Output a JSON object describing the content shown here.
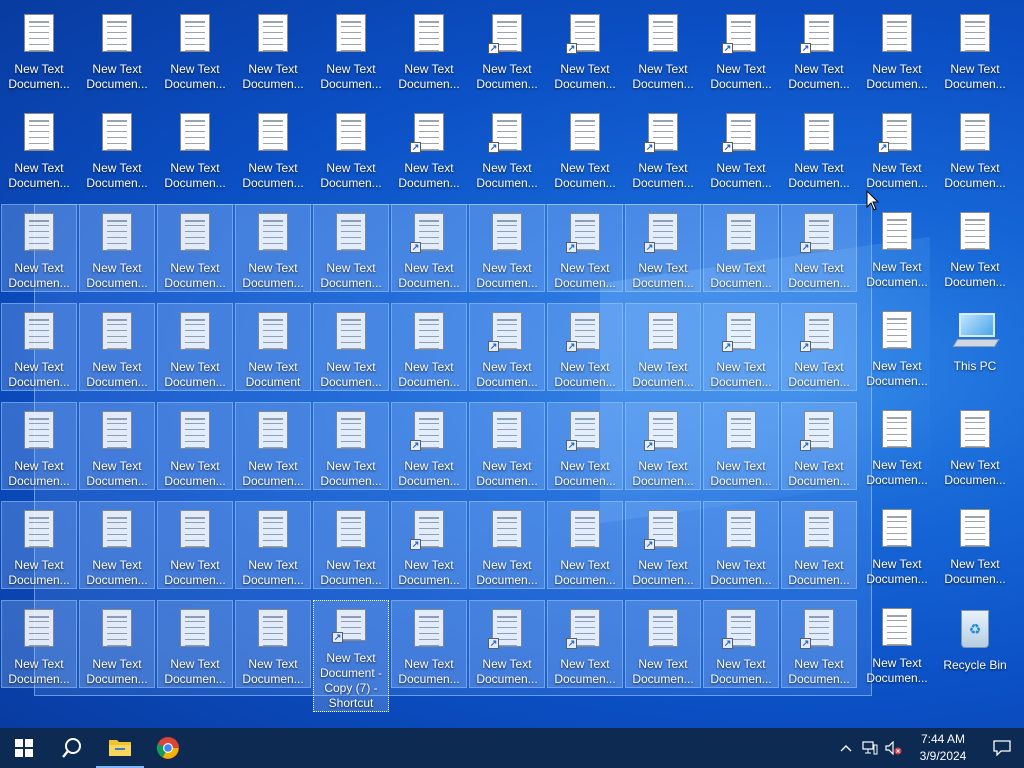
{
  "desktop": {
    "icon_label": "New Text Document - Copy (7) - Shortcut",
    "short_label": "New Text\nDocumen...",
    "full_label_variant": "New Text\nDocument",
    "this_pc_label": "This PC",
    "recycle_bin_label": "Recycle Bin",
    "focused_label": "New Text Document - Copy (7) - Shortcut"
  },
  "taskbar": {
    "apps": [
      "start-button",
      "search-button",
      "file-explorer",
      "chrome"
    ],
    "time": "7:44 AM",
    "date": "3/9/2024"
  }
}
